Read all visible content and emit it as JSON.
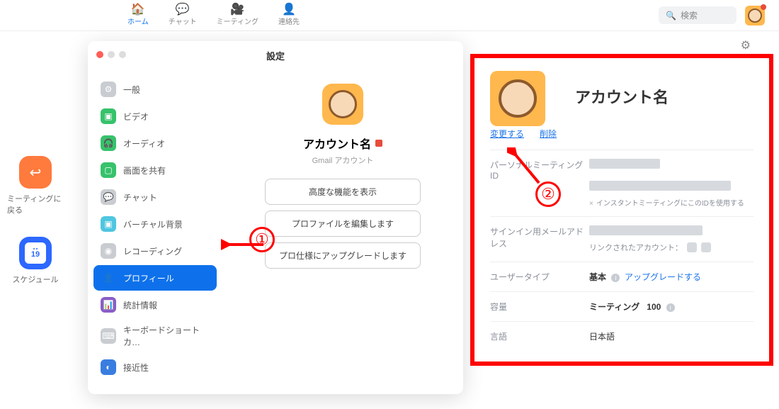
{
  "header": {
    "tabs": [
      {
        "label": "ホーム",
        "icon": "🏠",
        "active": true
      },
      {
        "label": "チャット",
        "icon": "💬",
        "active": false
      },
      {
        "label": "ミーティング",
        "icon": "🎥",
        "active": false
      },
      {
        "label": "連絡先",
        "icon": "👤",
        "active": false
      }
    ],
    "search_placeholder": "検索"
  },
  "left_rail": {
    "back_label": "ミーティングに戻る",
    "schedule_label": "スケジュール",
    "calendar_day": "19"
  },
  "settings": {
    "title": "設定",
    "nav": [
      {
        "label": "一般",
        "color": "#c9ccd1",
        "glyph": "⚙"
      },
      {
        "label": "ビデオ",
        "color": "#37c26b",
        "glyph": "▣"
      },
      {
        "label": "オーディオ",
        "color": "#37c26b",
        "glyph": "🎧"
      },
      {
        "label": "画面を共有",
        "color": "#37c26b",
        "glyph": "▢"
      },
      {
        "label": "チャット",
        "color": "#c9ccd1",
        "glyph": "💬"
      },
      {
        "label": "バーチャル背景",
        "color": "#4fc6e0",
        "glyph": "▣"
      },
      {
        "label": "レコーディング",
        "color": "#c9ccd1",
        "glyph": "◉"
      },
      {
        "label": "プロフィール",
        "color": "#0e71eb",
        "glyph": "👤",
        "active": true
      },
      {
        "label": "統計情報",
        "color": "#8a5cc6",
        "glyph": "📊"
      },
      {
        "label": "キーボードショートカ…",
        "color": "#c9ccd1",
        "glyph": "⌨"
      },
      {
        "label": "接近性",
        "color": "#3a7de0",
        "glyph": "◐"
      }
    ],
    "account_name": "アカウント名",
    "account_sub": "Gmail アカウント",
    "buttons": {
      "advanced": "高度な機能を表示",
      "edit_profile": "プロファイルを編集します",
      "upgrade": "プロ仕様にアップグレードします"
    }
  },
  "profile": {
    "title": "アカウント名",
    "change": "変更する",
    "delete": "削除",
    "rows": {
      "pmi_label": "パーソナルミーティングID",
      "instant_note": "インスタントミーティングにこのIDを使用する",
      "signin_label": "サインイン用メールアドレス",
      "linked_label": "リンクされたアカウント：",
      "usertype_label": "ユーザータイプ",
      "usertype_value": "基本",
      "upgrade_link": "アップグレードする",
      "capacity_label": "容量",
      "capacity_meeting": "ミーティング",
      "capacity_value": "100",
      "lang_label": "言語",
      "lang_value": "日本語"
    }
  },
  "annotations": {
    "one": "①",
    "two": "②"
  }
}
